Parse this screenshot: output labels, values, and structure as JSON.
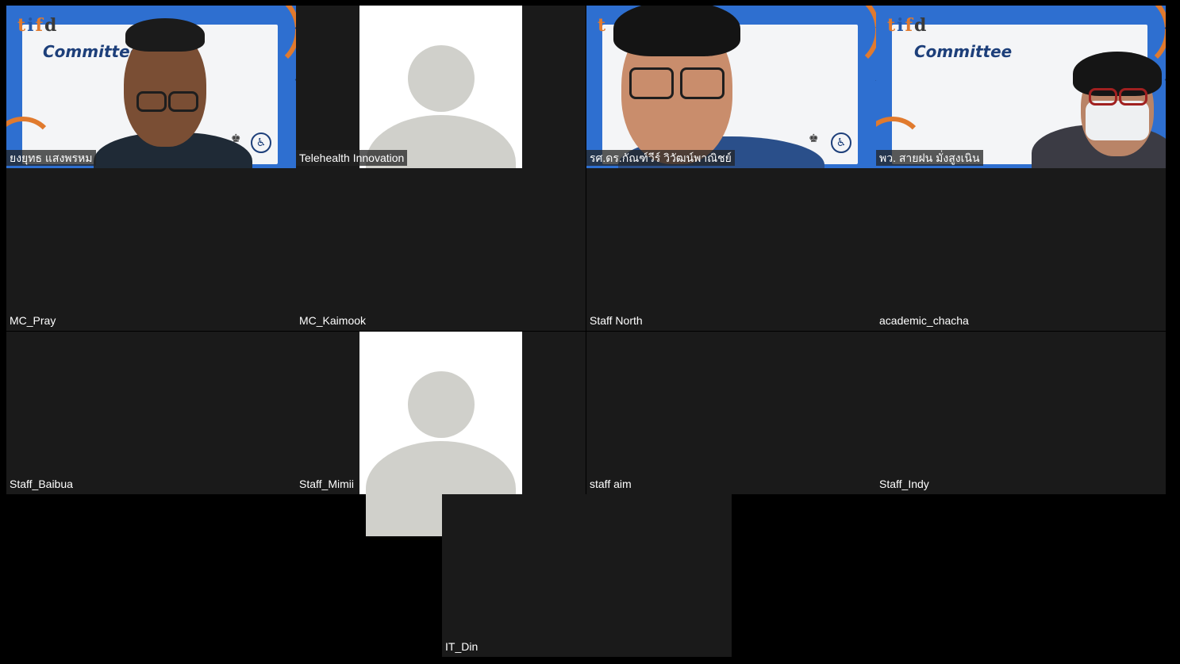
{
  "meeting": {
    "participants": [
      {
        "name": "ยงยุทธ แสงพรหม",
        "view": "video"
      },
      {
        "name": "Telehealth Innovation",
        "view": "avatar"
      },
      {
        "name": "รศ.ดร.กัณฑ์วีร์ วิวัฒน์พาณิชย์",
        "view": "video"
      },
      {
        "name": "พว. สายฝน มั่งสูงเนิน",
        "view": "video"
      },
      {
        "name": "MC_Pray",
        "view": "off"
      },
      {
        "name": "MC_Kaimook",
        "view": "off"
      },
      {
        "name": "Staff North",
        "view": "off"
      },
      {
        "name": "academic_chacha",
        "view": "off"
      },
      {
        "name": "Staff_Baibua",
        "view": "off"
      },
      {
        "name": "Staff_Mimii",
        "view": "avatar"
      },
      {
        "name": "staff aim",
        "view": "off"
      },
      {
        "name": "Staff_Indy",
        "view": "off"
      },
      {
        "name": "IT_Din",
        "view": "off"
      }
    ]
  },
  "backdrop": {
    "committee_text": "Committee",
    "logo_text": "tifd"
  },
  "colors": {
    "page_bg": "#000000",
    "tile_bg": "#1a1a1a",
    "backdrop_blue": "#2e6fd0",
    "avatar_grey": "#d0d0cb",
    "label_text": "#ffffff"
  }
}
